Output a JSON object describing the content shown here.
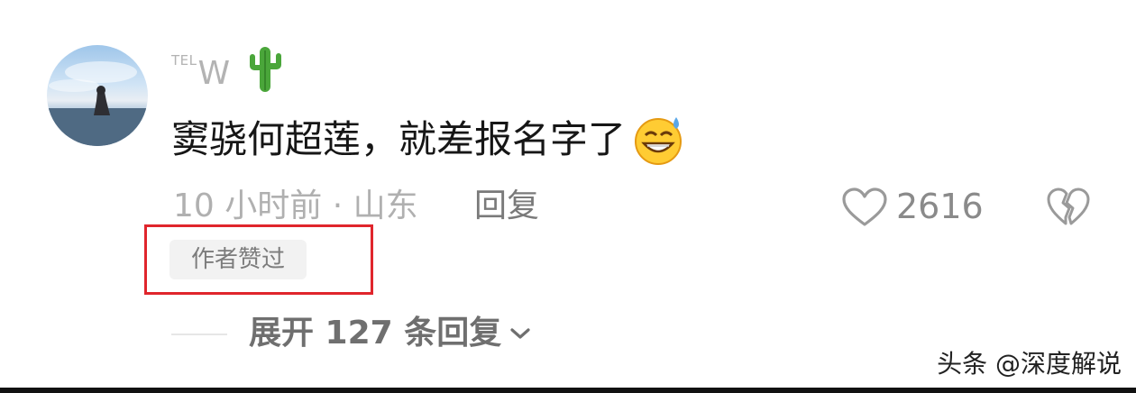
{
  "comment": {
    "user": {
      "name_prefix": "TEL",
      "name_main": "W"
    },
    "text": "窦骁何超莲，就差报名字了",
    "meta": "10 小时前 · 山东",
    "reply_label": "回复",
    "like_count": "2616",
    "author_badge": "作者赞过"
  },
  "expand_replies": "展开 127 条回复",
  "watermark": "头条 @深度解说",
  "icons": {
    "username_emoji": "cactus-icon",
    "comment_emoji": "grinning-sweat-icon",
    "like": "heart-outline-icon",
    "dislike": "broken-heart-icon",
    "expand": "chevron-down-icon"
  },
  "colors": {
    "highlight_border": "#e0252c",
    "badge_bg": "#f2f2f2",
    "text_primary": "#161616",
    "text_secondary": "#b0b0b0"
  }
}
